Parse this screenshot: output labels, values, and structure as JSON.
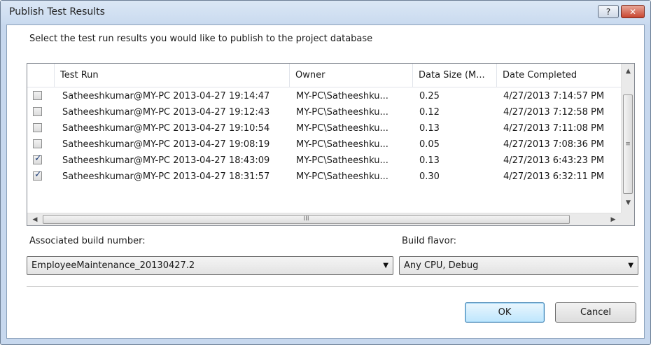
{
  "window": {
    "title": "Publish Test Results",
    "help_glyph": "?",
    "close_glyph": "✕"
  },
  "prompt": "Select the test run results you would like to publish to the project database",
  "table": {
    "columns": [
      "Test Run",
      "Owner",
      "Data Size (M...",
      "Date Completed"
    ],
    "rows": [
      {
        "checked": false,
        "test_run": "Satheeshkumar@MY-PC 2013-04-27 19:14:47",
        "owner": "MY-PC\\Satheeshku...",
        "size": "0.25",
        "date": "4/27/2013 7:14:57 PM"
      },
      {
        "checked": false,
        "test_run": "Satheeshkumar@MY-PC 2013-04-27 19:12:43",
        "owner": "MY-PC\\Satheeshku...",
        "size": "0.12",
        "date": "4/27/2013 7:12:58 PM"
      },
      {
        "checked": false,
        "test_run": "Satheeshkumar@MY-PC 2013-04-27 19:10:54",
        "owner": "MY-PC\\Satheeshku...",
        "size": "0.13",
        "date": "4/27/2013 7:11:08 PM"
      },
      {
        "checked": false,
        "test_run": "Satheeshkumar@MY-PC 2013-04-27 19:08:19",
        "owner": "MY-PC\\Satheeshku...",
        "size": "0.05",
        "date": "4/27/2013 7:08:36 PM"
      },
      {
        "checked": true,
        "test_run": "Satheeshkumar@MY-PC 2013-04-27 18:43:09",
        "owner": "MY-PC\\Satheeshku...",
        "size": "0.13",
        "date": "4/27/2013 6:43:23 PM"
      },
      {
        "checked": true,
        "test_run": "Satheeshkumar@MY-PC 2013-04-27 18:31:57",
        "owner": "MY-PC\\Satheeshku...",
        "size": "0.30",
        "date": "4/27/2013 6:32:11 PM"
      }
    ],
    "check_glyph": "✓"
  },
  "scrollbars": {
    "up_glyph": "▲",
    "down_glyph": "▼",
    "left_glyph": "◀",
    "right_glyph": "▶",
    "grip_v": "≡",
    "grip_h": "III"
  },
  "build_number": {
    "label": "Associated build number:",
    "value": "EmployeeMaintenance_20130427.2"
  },
  "build_flavor": {
    "label": "Build flavor:",
    "value": "Any CPU, Debug"
  },
  "combo_arrow_glyph": "▼",
  "buttons": {
    "ok": "OK",
    "cancel": "Cancel"
  },
  "colors": {
    "title_bg": "#c9daef",
    "close_red": "#c8452f",
    "default_button": "#bee6fd"
  }
}
